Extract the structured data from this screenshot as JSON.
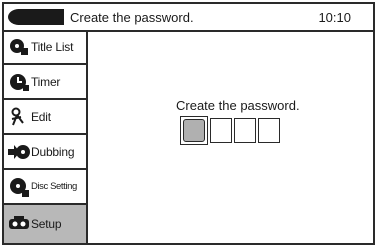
{
  "header": {
    "title": "Create the password.",
    "clock": "10:10"
  },
  "sidebar": {
    "items": [
      {
        "label": "Title List",
        "icon": "title-list-icon",
        "active": false
      },
      {
        "label": "Timer",
        "icon": "timer-icon",
        "active": false
      },
      {
        "label": "Edit",
        "icon": "edit-icon",
        "active": false
      },
      {
        "label": "Dubbing",
        "icon": "dubbing-icon",
        "active": false
      },
      {
        "label": "Disc Setting",
        "icon": "disc-setting-icon",
        "active": false
      },
      {
        "label": "Setup",
        "icon": "setup-icon",
        "active": true
      }
    ]
  },
  "main": {
    "prompt": "Create the password.",
    "password": {
      "length": 4,
      "entered": 0,
      "focused_index": 0
    }
  },
  "colors": {
    "border": "#2a2a2a",
    "active_bg": "#b8b8b8",
    "focus_fill": "#b0b0b0"
  }
}
